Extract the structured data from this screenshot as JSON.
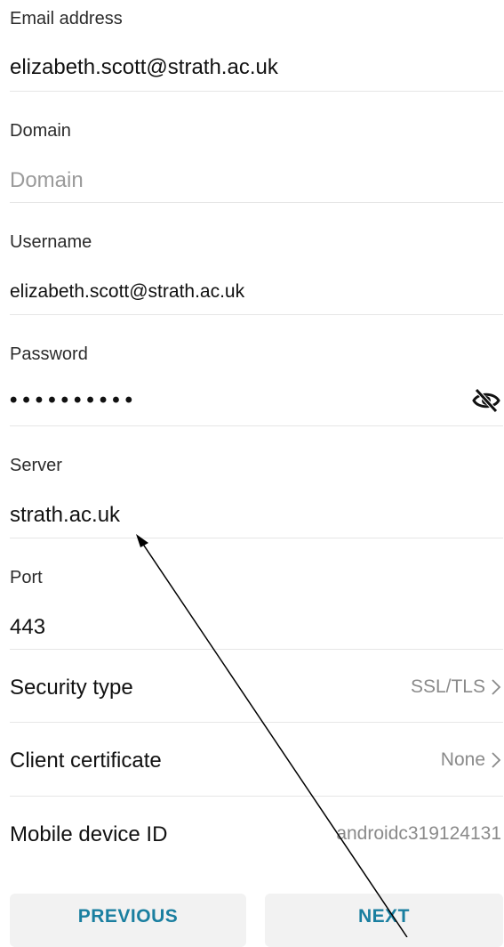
{
  "fields": {
    "email": {
      "label": "Email address",
      "value": "elizabeth.scott@strath.ac.uk"
    },
    "domain": {
      "label": "Domain",
      "placeholder": "Domain"
    },
    "username": {
      "label": "Username",
      "value": "elizabeth.scott@strath.ac.uk"
    },
    "password": {
      "label": "Password",
      "value": "••••••••••"
    },
    "server": {
      "label": "Server",
      "value": "strath.ac.uk"
    },
    "port": {
      "label": "Port",
      "value": "443"
    }
  },
  "rows": {
    "security_type": {
      "label": "Security type",
      "value": "SSL/TLS"
    },
    "client_certificate": {
      "label": "Client certificate",
      "value": "None"
    },
    "mobile_device_id": {
      "label": "Mobile device ID",
      "value": "androidc319124131"
    }
  },
  "buttons": {
    "previous": "PREVIOUS",
    "next": "NEXT"
  },
  "colors": {
    "accent": "#1a7fa0",
    "button_bg": "#f2f2f2",
    "divider": "#e6e6e6",
    "secondary_text": "#8a8a8a"
  },
  "icons": {
    "password_toggle": "eye-off-icon",
    "row_chevron": "chevron-right-icon"
  }
}
